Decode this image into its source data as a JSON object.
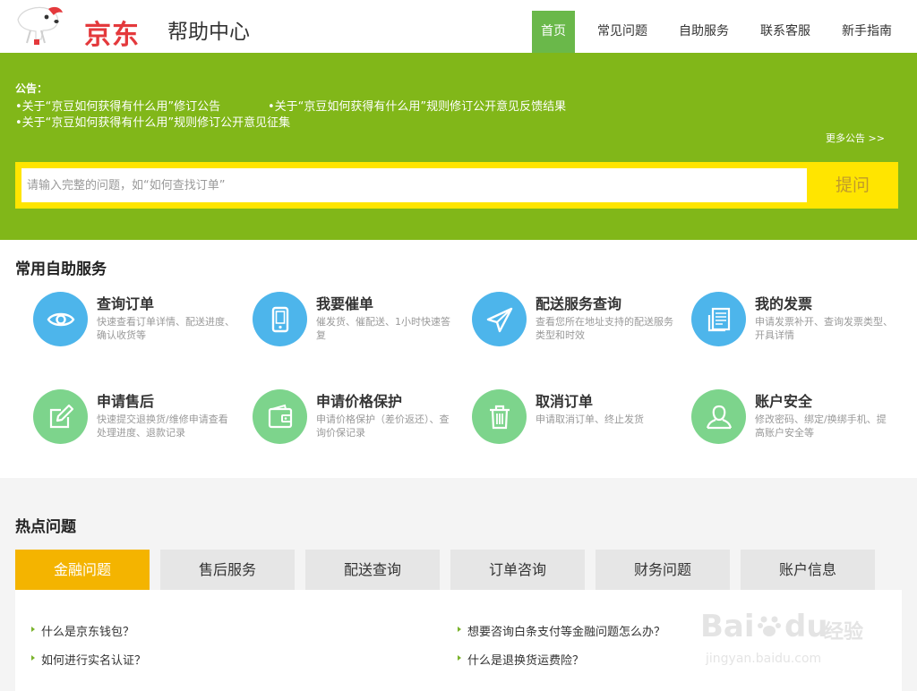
{
  "header": {
    "logo_text": "京东",
    "title": "帮助中心",
    "nav": [
      "首页",
      "常见问题",
      "自助服务",
      "联系客服",
      "新手指南"
    ]
  },
  "banner": {
    "notice_label": "公告：",
    "notices": [
      "•关于“京豆如何获得有什么用”修订公告",
      "•关于“京豆如何获得有什么用”规则修订公开意见反馈结果",
      "•关于“京豆如何获得有什么用”规则修订公开意见征集"
    ],
    "more": "更多公告 >>",
    "search_placeholder": "请输入完整的问题，如“如何查找订单”",
    "ask_label": "提问"
  },
  "services": {
    "title": "常用自助服务",
    "items": [
      {
        "title": "查询订单",
        "desc": "快速查看订单详情、配送进度、确认收货等",
        "icon": "eye-icon",
        "color": "blue"
      },
      {
        "title": "我要催单",
        "desc": "催发货、催配送、1小时快速答复",
        "icon": "phone-icon",
        "color": "blue"
      },
      {
        "title": "配送服务查询",
        "desc": "查看您所在地址支持的配送服务类型和时效",
        "icon": "paper-plane-icon",
        "color": "blue"
      },
      {
        "title": "我的发票",
        "desc": "申请发票补开、查询发票类型、开具详情",
        "icon": "invoice-icon",
        "color": "blue"
      },
      {
        "title": "申请售后",
        "desc": "快速提交退换货/维修申请查看处理进度、退款记录",
        "icon": "edit-icon",
        "color": "green"
      },
      {
        "title": "申请价格保护",
        "desc": "申请价格保护（差价返还）、查询价保记录",
        "icon": "wallet-icon",
        "color": "green"
      },
      {
        "title": "取消订单",
        "desc": "申请取消订单、终止发货",
        "icon": "trash-icon",
        "color": "green"
      },
      {
        "title": "账户安全",
        "desc": "修改密码、绑定/换绑手机、提高账户安全等",
        "icon": "user-icon",
        "color": "green"
      }
    ]
  },
  "hot": {
    "title": "热点问题",
    "tabs": [
      "金融问题",
      "售后服务",
      "配送查询",
      "订单咨询",
      "财务问题",
      "账户信息"
    ],
    "questions": [
      "什么是京东钱包？",
      "想要咨询白条支付等金融问题怎么办？",
      "如何进行实名认证？",
      "什么是退换货运费险？"
    ]
  },
  "watermark": {
    "brand": "Bai",
    "brand2": "du",
    "cn": "经验",
    "url": "jingyan.baidu.com"
  },
  "colors": {
    "banner": "#81b719",
    "nav_active": "#6ab84a",
    "search_border": "#ffe500",
    "tab_active": "#f4b400",
    "icon_blue": "#4db5eb",
    "icon_green": "#7dd48c",
    "logo_red": "#e4393c"
  }
}
